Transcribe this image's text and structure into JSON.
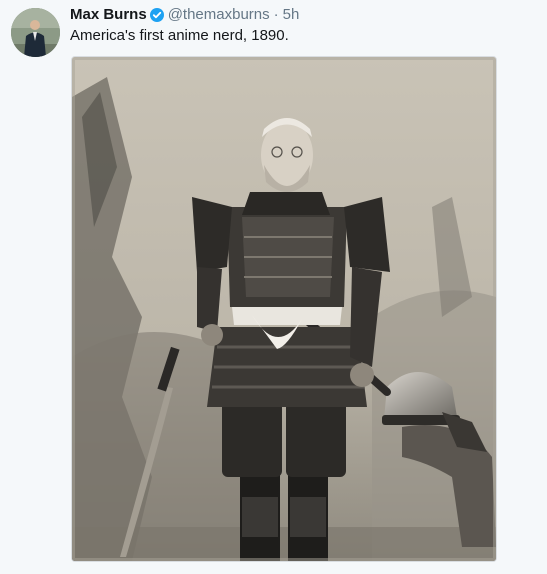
{
  "tweet": {
    "author_name": "Max Burns",
    "handle": "@themaxburns",
    "separator": "·",
    "time": "5h",
    "verified": true,
    "text": "America's first anime nerd, 1890."
  },
  "icons": {
    "verified": "verified-badge-icon",
    "avatar": "profile-photo"
  },
  "colors": {
    "background": "#f5f8fa",
    "name": "#14171a",
    "secondary": "#657786",
    "verified": "#1da1f2"
  }
}
